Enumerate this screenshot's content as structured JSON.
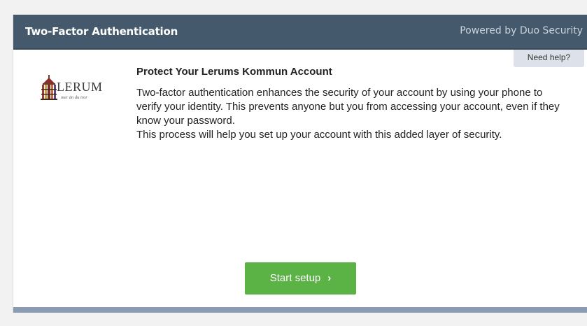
{
  "header": {
    "title": "Two-Factor Authentication",
    "powered_by": "Powered by Duo Security"
  },
  "help": {
    "label": "Need help?"
  },
  "logo": {
    "name": "LERUM",
    "tagline": "mer än du tror"
  },
  "content": {
    "title": "Protect Your Lerums Kommun Account",
    "paragraph_1": "Two-factor authentication enhances the security of your account by using your phone to verify your identity. This prevents anyone but you from accessing your account, even if they know your password.",
    "paragraph_2": "This process will help you set up your account with this added layer of security."
  },
  "actions": {
    "start_label": "Start setup",
    "start_chevron": "›"
  },
  "colors": {
    "header_bg": "#45596c",
    "primary_button": "#5bb346",
    "footer_bar": "#8a9cb3"
  }
}
